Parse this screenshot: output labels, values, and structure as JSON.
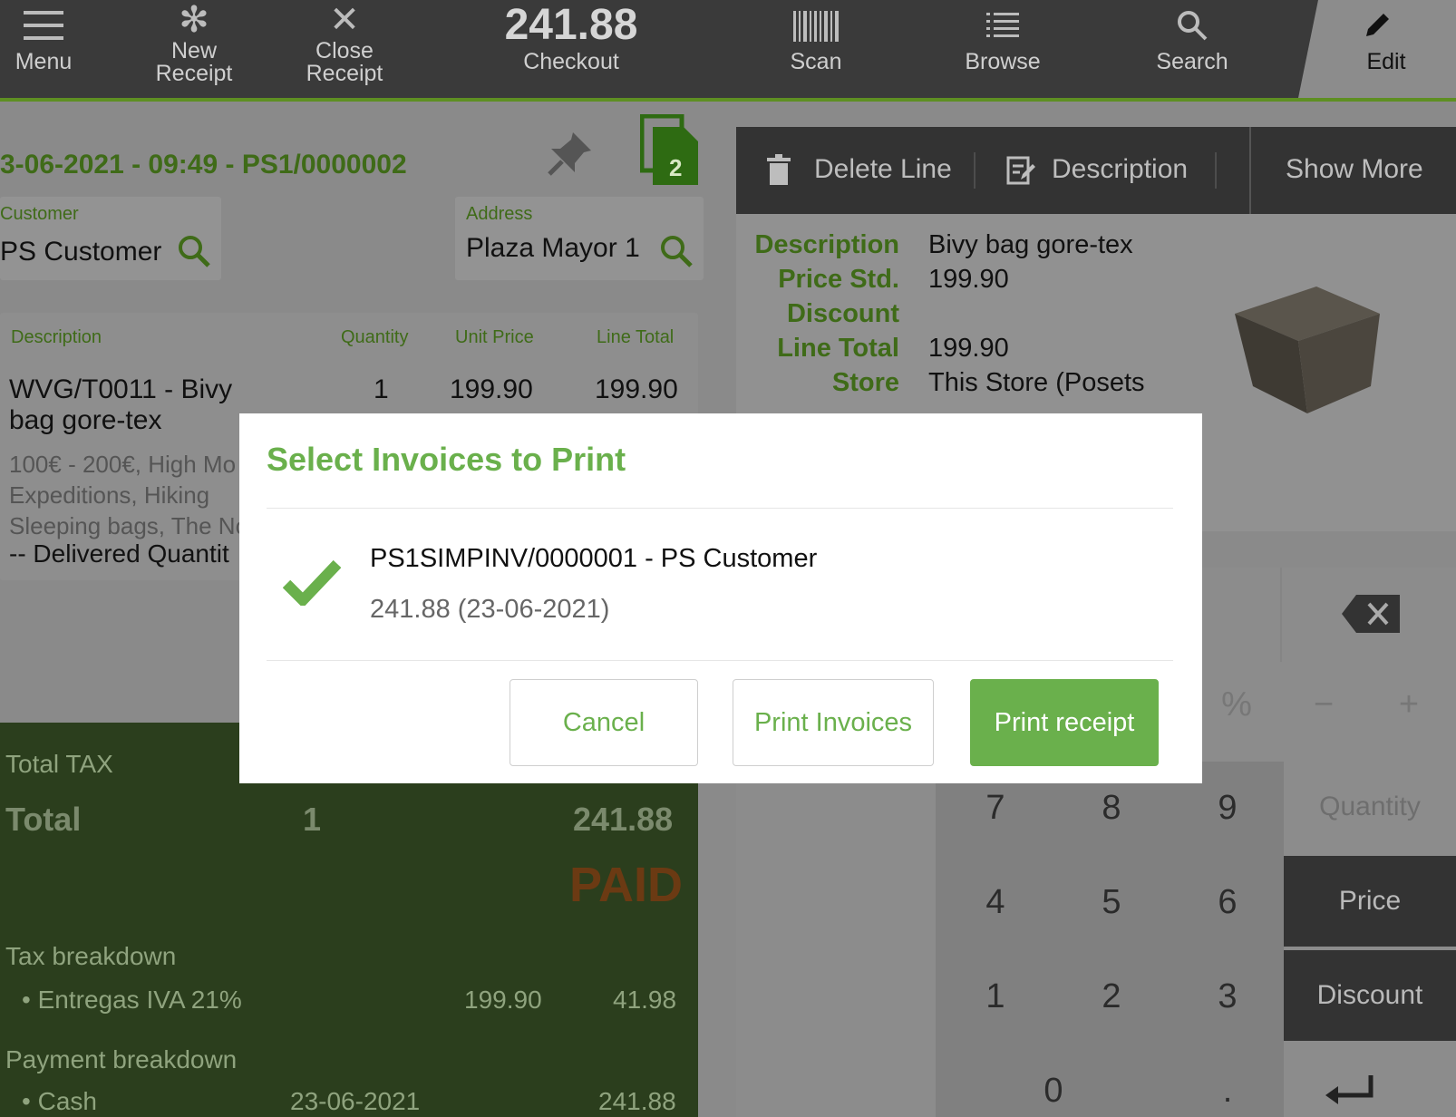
{
  "toolbar": {
    "menu": "Menu",
    "new_receipt": "New\nReceipt",
    "close_receipt": "Close\nReceipt",
    "checkout_amount": "241.88",
    "checkout": "Checkout",
    "scan": "Scan",
    "browse": "Browse",
    "search": "Search",
    "edit": "Edit"
  },
  "receipt": {
    "header": "3-06-2021 - 09:49 - PS1/0000002",
    "doc_count": "2",
    "customer_label": "Customer",
    "customer_value": "PS Customer",
    "address_label": "Address",
    "address_value": "Plaza Mayor 1"
  },
  "lines": {
    "headers": {
      "description": "Description",
      "quantity": "Quantity",
      "unit_price": "Unit Price",
      "line_total": "Line Total"
    },
    "item": {
      "description": "WVG/T0011 - Bivy bag gore-tex",
      "quantity": "1",
      "unit_price": "199.90",
      "line_total": "199.90",
      "categories": "100€ - 200€, High Mo & Expeditions, Hiking Sleeping bags, The No",
      "delivered": "-- Delivered Quantit"
    }
  },
  "totals": {
    "total_tax_label": "Total TAX",
    "total_label": "Total",
    "total_qty": "1",
    "total_amount": "241.88",
    "paid": "PAID",
    "tax_breakdown_label": "Tax breakdown",
    "tax_name": "Entregas IVA 21%",
    "tax_base": "199.90",
    "tax_amount": "41.98",
    "payment_breakdown_label": "Payment breakdown",
    "payment_name": "Cash",
    "payment_date": "23-06-2021",
    "payment_amount": "241.88"
  },
  "actions": {
    "delete_line": "Delete Line",
    "description": "Description",
    "show_more": "Show More"
  },
  "details": {
    "description_label": "Description",
    "description_value": "Bivy bag gore-tex",
    "price_std_label": "Price Std.",
    "price_std_value": "199.90",
    "discount_label": "Discount",
    "line_total_label": "Line Total",
    "line_total_value": "199.90",
    "store_label": "Store",
    "store_value": "This Store (Posets"
  },
  "keypad": {
    "percent": "%",
    "minus": "−",
    "plus": "+",
    "k7": "7",
    "k8": "8",
    "k9": "9",
    "k4": "4",
    "k5": "5",
    "k6": "6",
    "k1": "1",
    "k2": "2",
    "k3": "3",
    "k0": "0",
    "dot": ".",
    "quantity": "Quantity",
    "price": "Price",
    "discount": "Discount"
  },
  "dialog": {
    "title": "Select Invoices to Print",
    "invoice_title": "PS1SIMPINV/0000001 - PS Customer",
    "invoice_sub": "241.88 (23-06-2021)",
    "cancel": "Cancel",
    "print_invoices": "Print Invoices",
    "print_receipt": "Print receipt"
  },
  "colors": {
    "accent": "#6ab04c",
    "toolbar_bg": "#3a3a3a",
    "totals_bg": "#2b3e1d",
    "paid": "#6b3a13"
  }
}
